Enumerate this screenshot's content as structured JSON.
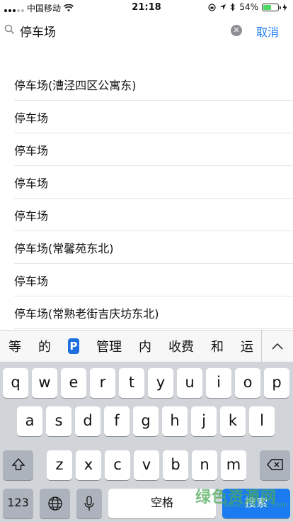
{
  "status_bar": {
    "carrier": "中国移动",
    "time": "21:18",
    "battery_percent": "54%",
    "battery_level": 0.54
  },
  "search": {
    "query": "停车场",
    "cancel_label": "取消"
  },
  "results": [
    {
      "label": "停车场(漕泾四区公寓东)"
    },
    {
      "label": "停车场"
    },
    {
      "label": "停车场"
    },
    {
      "label": "停车场"
    },
    {
      "label": "停车场"
    },
    {
      "label": "停车场(常馨苑东北)"
    },
    {
      "label": "停车场"
    },
    {
      "label": "停车场(常熟老街吉庆坊东北)"
    }
  ],
  "suggestions": [
    "等",
    "的",
    "P",
    "管理",
    "内",
    "收费",
    "和",
    "运"
  ],
  "keyboard": {
    "row1": [
      "q",
      "w",
      "e",
      "r",
      "t",
      "y",
      "u",
      "i",
      "o",
      "p"
    ],
    "row2": [
      "a",
      "s",
      "d",
      "f",
      "g",
      "h",
      "j",
      "k",
      "l"
    ],
    "row3": [
      "z",
      "x",
      "c",
      "v",
      "b",
      "n",
      "m"
    ],
    "numbers_label": "123",
    "space_label": "空格",
    "search_label": "搜索"
  },
  "watermark": {
    "text": "绿色资源网",
    "url": "www.downcc.com"
  },
  "colors": {
    "accent": "#1a7cf3",
    "keyboard_bg": "#d1d4d9",
    "battery": "#4cd964"
  }
}
